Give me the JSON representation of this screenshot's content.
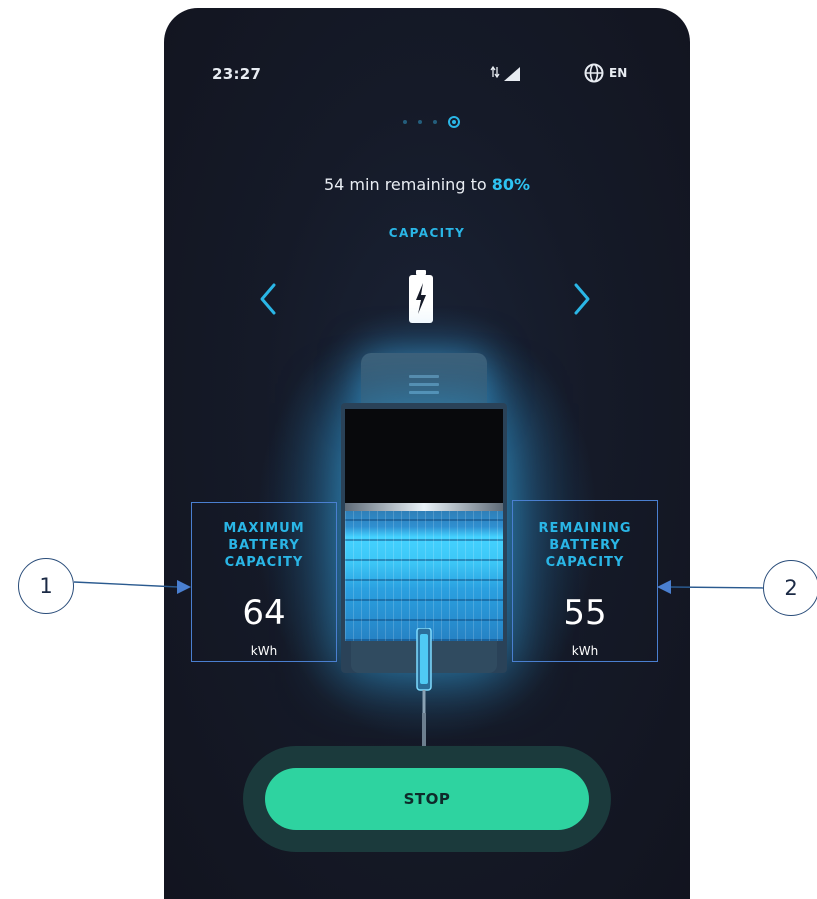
{
  "status": {
    "time": "23:27",
    "language": "EN"
  },
  "pager": {
    "pages": 4,
    "active": 4
  },
  "charging": {
    "time_remaining": "54 min remaining to",
    "target": "80%"
  },
  "section": {
    "title": "CAPACITY"
  },
  "max_capacity": {
    "label_line1": "MAXIMUM",
    "label_line2": "BATTERY",
    "label_line3": "CAPACITY",
    "value": "64",
    "unit": "kWh"
  },
  "remaining_capacity": {
    "label_line1": "REMAINING",
    "label_line2": "BATTERY",
    "label_line3": "CAPACITY",
    "value": "55",
    "unit": "kWh"
  },
  "actions": {
    "stop_label": "STOP"
  },
  "callouts": {
    "left": "1",
    "right": "2"
  },
  "colors": {
    "accent": "#2ab6e6",
    "stop_button": "#2ed3a0",
    "background": "#151a28"
  },
  "icons": {
    "signal": "signal-icon",
    "language": "globe-icon",
    "prev": "chevron-left-icon",
    "next": "chevron-right-icon",
    "battery": "battery-charging-icon"
  }
}
